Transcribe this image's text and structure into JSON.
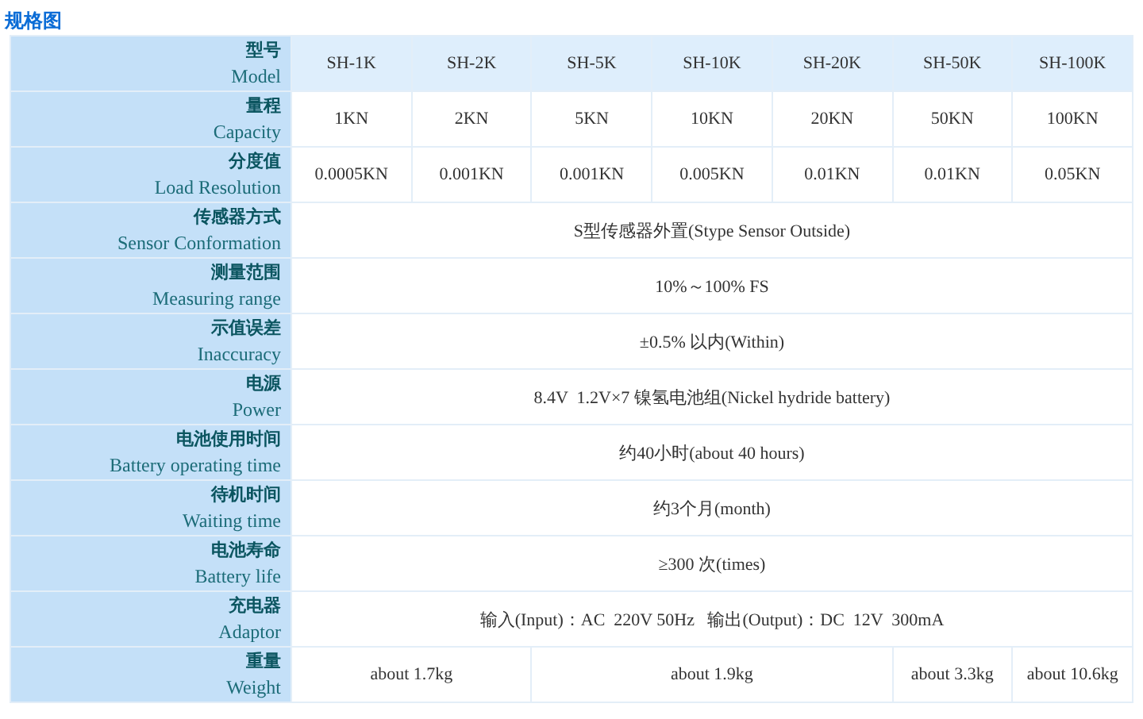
{
  "title": "规格图",
  "header": {
    "label_zh": "型号",
    "label_en": "Model",
    "models": [
      "SH-1K",
      "SH-2K",
      "SH-5K",
      "SH-10K",
      "SH-20K",
      "SH-50K",
      "SH-100K"
    ]
  },
  "rows": [
    {
      "label_zh": "量程",
      "label_en": "Capacity",
      "cells": [
        "1KN",
        "2KN",
        "5KN",
        "10KN",
        "20KN",
        "50KN",
        "100KN"
      ]
    },
    {
      "label_zh": "分度值",
      "label_en": "Load Resolution",
      "cells": [
        "0.0005KN",
        "0.001KN",
        "0.001KN",
        "0.005KN",
        "0.01KN",
        "0.01KN",
        "0.05KN"
      ]
    },
    {
      "label_zh": "传感器方式",
      "label_en": "Sensor Conformation",
      "value": "S型传感器外置(Stype Sensor Outside)"
    },
    {
      "label_zh": "测量范围",
      "label_en": "Measuring range",
      "value": "10%～100% FS"
    },
    {
      "label_zh": "示值误差",
      "label_en": "Inaccuracy",
      "value": "±0.5% 以内(Within)"
    },
    {
      "label_zh": "电源",
      "label_en": "Power",
      "value": "8.4V  1.2V×7 镍氢电池组(Nickel hydride battery)"
    },
    {
      "label_zh": "电池使用时间",
      "label_en": "Battery operating time",
      "value": "约40小时(about 40 hours)"
    },
    {
      "label_zh": "待机时间",
      "label_en": "Waiting time",
      "value": "约3个月(month)"
    },
    {
      "label_zh": "电池寿命",
      "label_en": "Battery life",
      "value": "≥300 次(times)"
    },
    {
      "label_zh": "充电器",
      "label_en": "Adaptor",
      "value": "输入(Input)：AC  220V 50Hz   输出(Output)：DC  12V  300mA"
    },
    {
      "label_zh": "重量",
      "label_en": "Weight",
      "cells": [
        "about 1.7kg",
        null,
        "about 1.9kg",
        null,
        null,
        "about 3.3kg",
        "about 10.6kg"
      ]
    }
  ]
}
